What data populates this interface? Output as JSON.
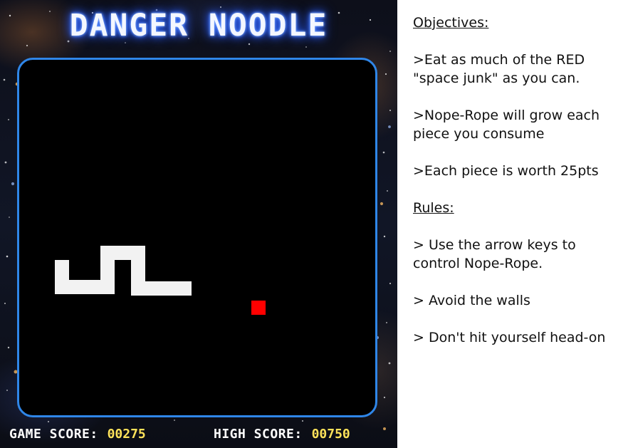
{
  "game": {
    "title": "DANGER NOODLE",
    "score_label": "GAME SCORE:",
    "score_value": "00275",
    "high_score_label": "HIGH SCORE:",
    "high_score_value": "00750",
    "colors": {
      "board_border": "#2f86e8",
      "board_bg": "#000000",
      "snake": "#f2f2f2",
      "food": "#ff0000",
      "score_value": "#ffe35a"
    }
  },
  "info": {
    "objectives_title": "Objectives:",
    "objectives": [
      ">Eat as much of the RED \"space junk\" as you can.",
      ">Nope-Rope will grow each piece you consume",
      ">Each piece is worth 25pts"
    ],
    "rules_title": "Rules:",
    "rules": [
      "> Use the arrow keys to control Nope-Rope.",
      "> Avoid the walls",
      "> Don't hit yourself head-on"
    ]
  }
}
